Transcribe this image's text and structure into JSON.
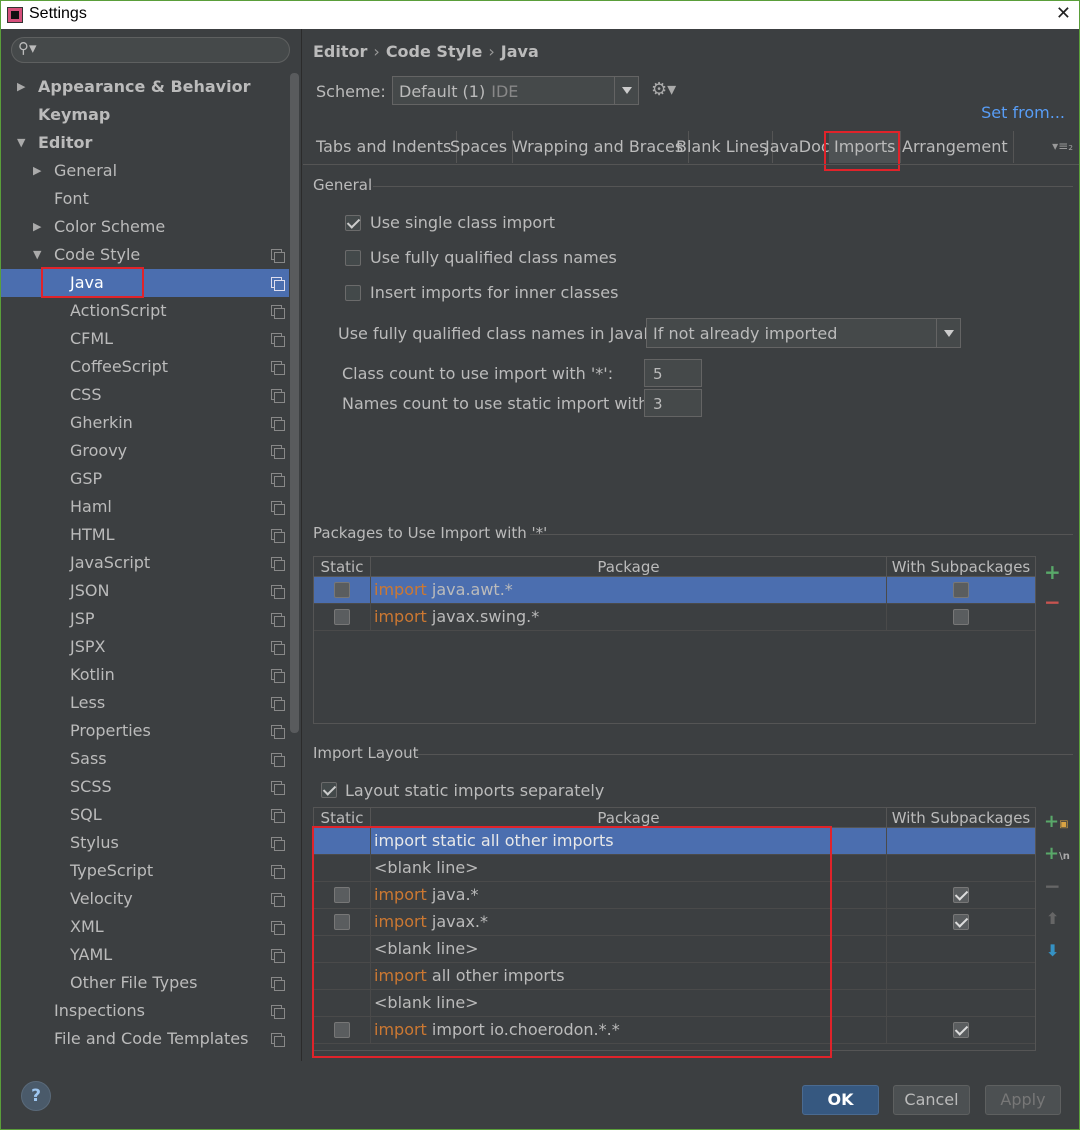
{
  "window": {
    "title": "Settings"
  },
  "sidebar": {
    "items": [
      {
        "label": "Appearance & Behavior"
      },
      {
        "label": "Keymap"
      },
      {
        "label": "Editor"
      },
      {
        "label": "General"
      },
      {
        "label": "Font"
      },
      {
        "label": "Color Scheme"
      },
      {
        "label": "Code Style"
      },
      {
        "label": "Java"
      },
      {
        "label": "ActionScript"
      },
      {
        "label": "CFML"
      },
      {
        "label": "CoffeeScript"
      },
      {
        "label": "CSS"
      },
      {
        "label": "Gherkin"
      },
      {
        "label": "Groovy"
      },
      {
        "label": "GSP"
      },
      {
        "label": "Haml"
      },
      {
        "label": "HTML"
      },
      {
        "label": "JavaScript"
      },
      {
        "label": "JSON"
      },
      {
        "label": "JSP"
      },
      {
        "label": "JSPX"
      },
      {
        "label": "Kotlin"
      },
      {
        "label": "Less"
      },
      {
        "label": "Properties"
      },
      {
        "label": "Sass"
      },
      {
        "label": "SCSS"
      },
      {
        "label": "SQL"
      },
      {
        "label": "Stylus"
      },
      {
        "label": "TypeScript"
      },
      {
        "label": "Velocity"
      },
      {
        "label": "XML"
      },
      {
        "label": "YAML"
      },
      {
        "label": "Other File Types"
      },
      {
        "label": "Inspections"
      },
      {
        "label": "File and Code Templates"
      }
    ]
  },
  "breadcrumb": {
    "part1": "Editor",
    "part2": "Code Style",
    "part3": "Java",
    "sep": "›"
  },
  "scheme": {
    "label": "Scheme:",
    "value": "Default (1)",
    "qualifier": "IDE",
    "set_from": "Set from..."
  },
  "tabs": [
    "Tabs and Indents",
    "Spaces",
    "Wrapping and Braces",
    "Blank Lines",
    "JavaDoc",
    "Imports",
    "Arrangement"
  ],
  "general": {
    "title": "General",
    "opt_single_class": "Use single class import",
    "opt_fully_qualified": "Use fully qualified class names",
    "opt_inner_classes": "Insert imports for inner classes",
    "javadoc_label": "Use fully qualified class names in JavaDoc:",
    "javadoc_value": "If not already imported",
    "class_count_label": "Class count to use import with '*':",
    "class_count_value": "5",
    "names_count_label": "Names count to use static import with '*':",
    "names_count_value": "3"
  },
  "packages": {
    "title": "Packages to Use Import with '*'",
    "col_static": "Static",
    "col_package": "Package",
    "col_subpackages": "With Subpackages",
    "rows": [
      {
        "kw": "import",
        "pkg": "java.awt.*"
      },
      {
        "kw": "import",
        "pkg": "javax.swing.*"
      }
    ]
  },
  "layout": {
    "title": "Import Layout",
    "opt_static_separately": "Layout static imports separately",
    "col_static": "Static",
    "col_package": "Package",
    "col_subpackages": "With Subpackages",
    "rows": [
      {
        "kw": "",
        "pkg": "import static all other imports"
      },
      {
        "kw": "",
        "pkg": "<blank line>"
      },
      {
        "kw": "import",
        "pkg": "java.*"
      },
      {
        "kw": "import",
        "pkg": "javax.*"
      },
      {
        "kw": "",
        "pkg": "<blank line>"
      },
      {
        "kw": "import",
        "pkg": "all other imports"
      },
      {
        "kw": "",
        "pkg": "<blank line>"
      },
      {
        "kw": "import",
        "pkg": "import io.choerodon.*.*"
      }
    ]
  },
  "buttons": {
    "help": "?",
    "ok": "OK",
    "cancel": "Cancel",
    "apply": "Apply"
  },
  "colors": {
    "accent": "#4b6eaf",
    "keyword": "#cc7832",
    "link": "#589df6",
    "highlight": "#e0232a"
  }
}
